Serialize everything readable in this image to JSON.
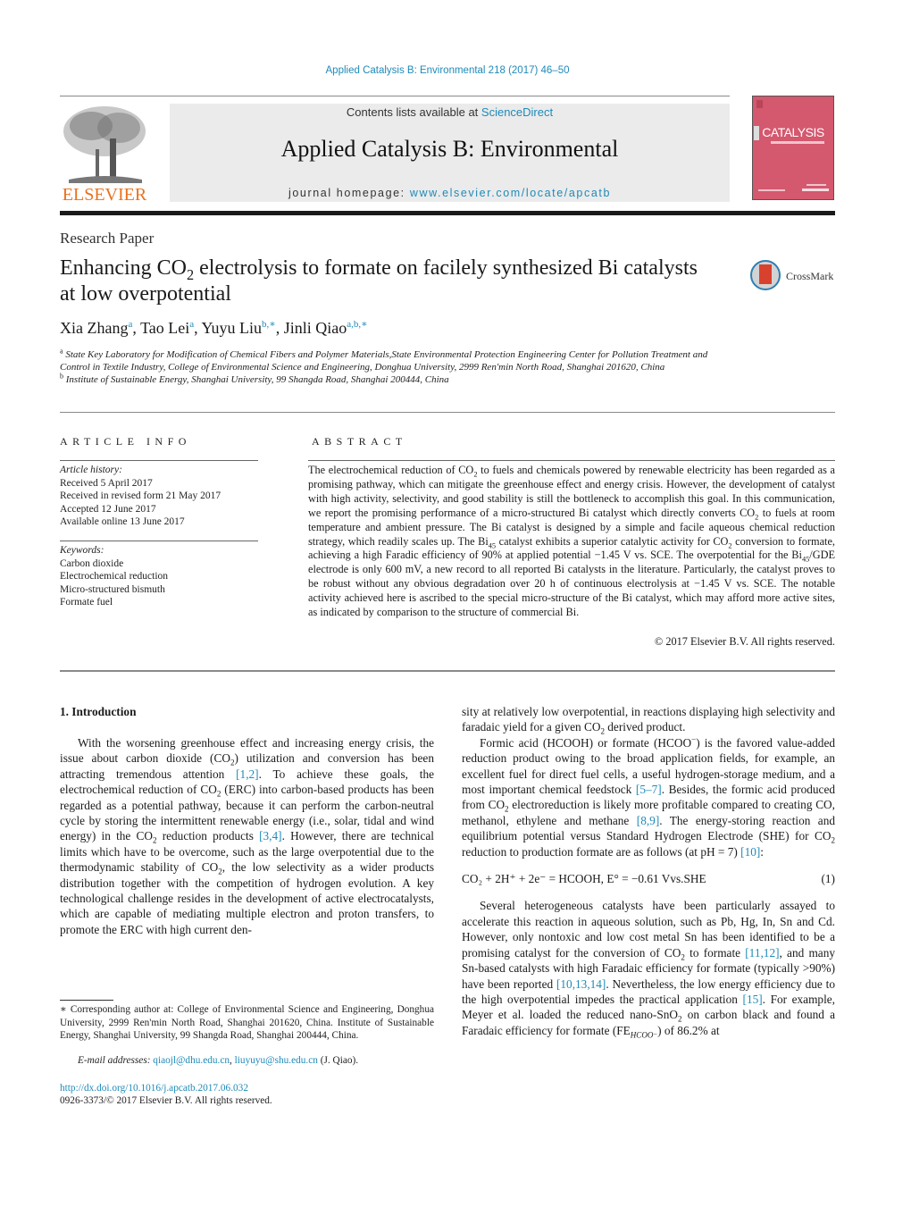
{
  "header": {
    "journal_ref": "Applied Catalysis B: Environmental 218 (2017) 46–50",
    "contents_prefix": "Contents lists available at ",
    "contents_link": "ScienceDirect",
    "journal_title": "Applied Catalysis B: Environmental",
    "homepage_prefix": "journal homepage: ",
    "homepage_link": "www.elsevier.com/locate/apcatb",
    "publisher_logo_text": "ELSEVIER",
    "cover_title": "CATALYSIS",
    "crossmark_label": "CrossMark",
    "colors": {
      "link": "#1f8ab8",
      "elsevier_orange": "#e9711c",
      "cover_pink": "#d4586e",
      "masthead_gray": "#ebebeb"
    }
  },
  "article": {
    "type": "Research Paper",
    "title_part1": "Enhancing CO",
    "title_sub": "2",
    "title_part2": " electrolysis to formate on facilely synthesized Bi catalysts at low overpotential",
    "authors": [
      {
        "name": "Xia Zhang",
        "sup": "a"
      },
      {
        "name": "Tao Lei",
        "sup": "a"
      },
      {
        "name": "Yuyu Liu",
        "sup": "b,∗"
      },
      {
        "name": "Jinli Qiao",
        "sup": "a,b,∗"
      }
    ],
    "affiliations": [
      {
        "mark": "a",
        "text": "State Key Laboratory for Modification of Chemical Fibers and Polymer Materials,State Environmental Protection Engineering Center for Pollution Treatment and Control in Textile Industry, College of Environmental Science and Engineering, Donghua University, 2999 Ren'min North Road, Shanghai 201620, China"
      },
      {
        "mark": "b",
        "text": "Institute of Sustainable Energy, Shanghai University, 99 Shangda Road, Shanghai 200444, China"
      }
    ]
  },
  "article_info": {
    "heading": "ARTICLE INFO",
    "history_label": "Article history:",
    "history": [
      "Received 5 April 2017",
      "Received in revised form 21 May 2017",
      "Accepted 12 June 2017",
      "Available online 13 June 2017"
    ],
    "keywords_label": "Keywords:",
    "keywords": [
      "Carbon dioxide",
      "Electrochemical reduction",
      "Micro-structured bismuth",
      "Formate fuel"
    ]
  },
  "abstract": {
    "heading": "ABSTRACT",
    "segments": [
      "The electrochemical reduction of CO",
      "2",
      " to fuels and chemicals powered by renewable electricity has been regarded as a promising pathway, which can mitigate the greenhouse effect and energy crisis. However, the development of catalyst with high activity, selectivity, and good stability is still the bottleneck to accomplish this goal. In this communication, we report the promising performance of a micro-structured Bi catalyst which directly converts CO",
      "2",
      " to fuels at room temperature and ambient pressure. The Bi catalyst is designed by a simple and facile aqueous chemical reduction strategy, which readily scales up. The Bi",
      "45",
      " catalyst exhibits a superior catalytic activity for CO",
      "2",
      " conversion to formate, achieving a high Faradic efficiency of 90% at applied potential −1.45 V vs. SCE. The overpotential for the Bi",
      "45",
      "/GDE electrode is only 600 mV, a new record to all reported Bi catalysts in the literature. Particularly, the catalyst proves to be robust without any obvious degradation over 20 h of continuous electrolysis at −1.45 V vs. SCE. The notable activity achieved here is ascribed to the special micro-structure of the Bi catalyst, which may afford more active sites, as indicated by comparison to the structure of commercial Bi."
    ],
    "copyright": "© 2017 Elsevier B.V. All rights reserved."
  },
  "body": {
    "section_heading": "1.  Introduction",
    "left_paragraph": [
      "With the worsening greenhouse effect and increasing energy crisis, the issue about carbon dioxide (CO",
      "2",
      ") utilization and conversion has been attracting tremendous attention ",
      "[1,2]",
      ". To achieve these goals, the electrochemical reduction of CO",
      "2",
      " (ERC) into carbon-based products has been regarded as a potential pathway, because it can perform the carbon-neutral cycle by storing the intermittent renewable energy (i.e., solar, tidal and wind energy) in the CO",
      "2",
      " reduction products ",
      "[3,4]",
      ". However, there are technical limits which have to be overcome, such as the large overpotential due to the thermodynamic stability of CO",
      "2",
      ", the low selectivity as a wider products distribution together with the competition of hydrogen evolution. A key technological challenge resides in the development of active electrocatalysts, which are capable of mediating multiple electron and proton transfers, to promote the ERC with high current den-"
    ],
    "right_p1": [
      "sity at relatively low overpotential, in reactions displaying high selectivity and faradaic yield for a given CO",
      "2",
      " derived product."
    ],
    "right_p2": [
      "Formic acid (HCOOH) or formate (HCOO",
      "−",
      ") is the favored value-added reduction product owing to the broad application fields, for example, an excellent fuel for direct fuel cells, a useful hydrogen-storage medium, and a most important chemical feedstock ",
      "[5–7]",
      ". Besides, the formic acid produced from CO",
      "2",
      " electroreduction is likely more profitable compared to creating CO, methanol, ethylene and methane ",
      "[8,9]",
      ". The energy-storing reaction and equilibrium potential versus Standard Hydrogen Electrode (SHE) for CO",
      "2",
      " reduction to production formate are as follows (at pH = 7) ",
      "[10]",
      ":"
    ],
    "equation": {
      "text": "CO₂ + 2H⁺ + 2e⁻ = HCOOH,    E° = −0.61 Vvs.SHE",
      "number": "(1)"
    },
    "right_p3": [
      "Several heterogeneous catalysts have been particularly assayed to accelerate this reaction in aqueous solution, such as Pb, Hg, In, Sn and Cd. However, only nontoxic and low cost metal Sn has been identified to be a promising catalyst for the conversion of CO",
      "2",
      " to formate ",
      "[11,12]",
      ", and many Sn-based catalysts with high Faradaic efficiency for formate (typically >90%) have been reported ",
      "[10,13,14]",
      ". Nevertheless, the low energy efficiency due to the high overpotential impedes the practical application ",
      "[15]",
      ". For example, Meyer et al. loaded the reduced nano-SnO",
      "2",
      " on carbon black and found a Faradaic efficiency for formate (FE",
      "HCOO⁻",
      ") of 86.2% at"
    ]
  },
  "footnotes": {
    "corresponding": "∗  Corresponding author at: College of Environmental Science and Engineering, Donghua University, 2999 Ren'min North Road, Shanghai 201620, China. Institute of Sustainable Energy, Shanghai University, 99 Shangda Road, Shanghai 200444, China.",
    "email_label": "E-mail addresses: ",
    "emails": [
      "qiaojl@dhu.edu.cn",
      "liuyuyu@shu.edu.cn"
    ],
    "email_suffix": " (J. Qiao).",
    "doi": "http://dx.doi.org/10.1016/j.apcatb.2017.06.032",
    "issn": "0926-3373/© 2017 Elsevier B.V. All rights reserved."
  }
}
